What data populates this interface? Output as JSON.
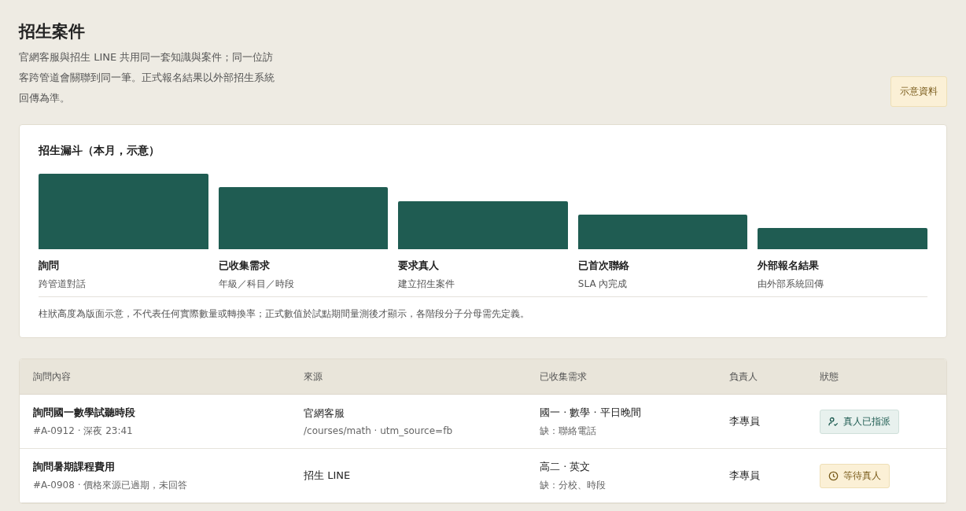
{
  "page": {
    "title": "招生案件",
    "description": "官網客服與招生 LINE 共用同一套知識與案件；同一位訪客跨管道會關聯到同一筆。正式報名結果以外部招生系統回傳為準。",
    "badge": "示意資料"
  },
  "funnel": {
    "title": "招生漏斗（本月，示意）",
    "stages": [
      {
        "label": "詢問",
        "sub": "跨管道對話"
      },
      {
        "label": "已收集需求",
        "sub": "年級／科目／時段"
      },
      {
        "label": "要求真人",
        "sub": "建立招生案件"
      },
      {
        "label": "已首次聯絡",
        "sub": "SLA 內完成"
      },
      {
        "label": "外部報名結果",
        "sub": "由外部系統回傳"
      }
    ],
    "note": "柱狀高度為版面示意，不代表任何實際數量或轉換率；正式數值於試點期間量測後才顯示，各階段分子分母需先定義。"
  },
  "table": {
    "columns": [
      "詢問內容",
      "來源",
      "已收集需求",
      "負責人",
      "狀態"
    ],
    "rows": [
      {
        "title": "詢問國一數學試聽時段",
        "meta": "#A-0912 · 深夜 23:41",
        "source": "官網客服",
        "source_detail": "/courses/math · utm_source=fb",
        "needs": "國一 · 數學 · 平日晚間",
        "missing": "缺：聯絡電話",
        "assignee": "李專員",
        "status": {
          "kind": "assigned",
          "label": "真人已指派"
        }
      },
      {
        "title": "詢問暑期課程費用",
        "meta": "#A-0908 · 價格來源已過期，未回答",
        "source": "招生 LINE",
        "needs": "高二 · 英文",
        "missing": "缺：分校、時段",
        "assignee": "李專員",
        "status": {
          "kind": "waiting",
          "label": "等待真人"
        }
      }
    ]
  }
}
